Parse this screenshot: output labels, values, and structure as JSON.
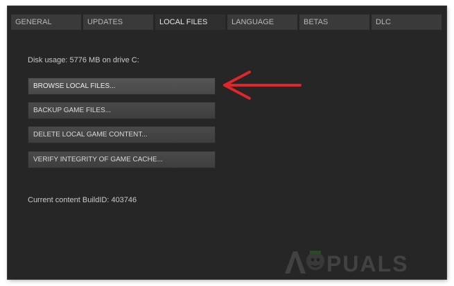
{
  "tabs": [
    {
      "label": "GENERAL"
    },
    {
      "label": "UPDATES"
    },
    {
      "label": "LOCAL FILES"
    },
    {
      "label": "LANGUAGE"
    },
    {
      "label": "BETAS"
    },
    {
      "label": "DLC"
    }
  ],
  "active_tab": "LOCAL FILES",
  "disk_usage": "Disk usage: 5776 MB on drive C:",
  "buttons": {
    "browse": "BROWSE LOCAL FILES...",
    "backup": "BACKUP GAME FILES...",
    "delete": "DELETE LOCAL GAME CONTENT...",
    "verify": "VERIFY INTEGRITY OF GAME CACHE..."
  },
  "build_id": "Current content BuildID: 403746",
  "annotation": {
    "arrow_color": "#e0252b",
    "points_to": "browse-local-files-button"
  },
  "watermark": {
    "text": "APPUALS",
    "icon": "appuals-mascot-icon"
  },
  "colors": {
    "background": "#262626",
    "tab": "#3a3a3a",
    "button": "#444444",
    "text": "#c9c9c9"
  }
}
